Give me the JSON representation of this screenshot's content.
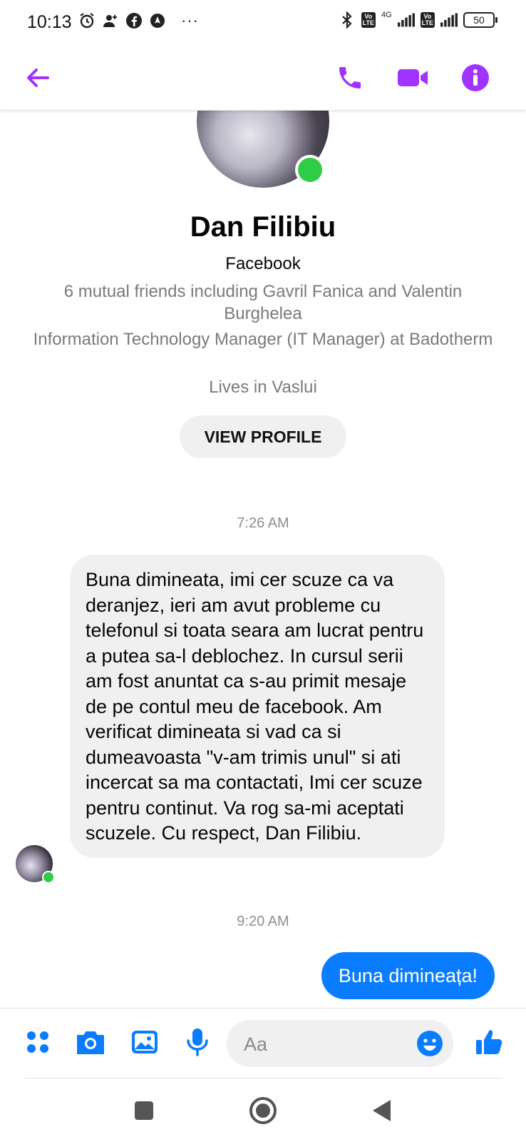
{
  "status_bar": {
    "time": "10:13",
    "network": "4G",
    "battery": "50",
    "more": "···"
  },
  "header": {
    "accent_color": "#a033ff",
    "back_icon": "back-arrow-icon",
    "call_icon": "phone-icon",
    "video_icon": "video-camera-icon",
    "info_icon": "info-icon"
  },
  "profile": {
    "name": "Dan Filibiu",
    "platform": "Facebook",
    "mutual_friends": "6 mutual friends including Gavril Fanica and Valentin Burghelea",
    "work": "Information Technology Manager (IT Manager) at Badotherm",
    "location": "Lives in Vaslui",
    "view_profile_label": "VIEW PROFILE",
    "online": true
  },
  "conversation": {
    "timestamp_1": "7:26 AM",
    "incoming_message": "Buna dimineata, imi cer scuze ca va deranjez, ieri am avut probleme cu telefonul si toata seara am lucrat pentru a putea sa-l deblochez. In cursul serii am fost anuntat ca s-au primit mesaje de pe contul meu de facebook. Am verificat dimineata si vad ca si dumeavoasta \"v-am trimis unul\" si ati incercat sa ma contactati, Imi cer scuze pentru continut. Va rog sa-mi aceptati scuzele. Cu respect, Dan Filibiu.",
    "timestamp_2": "9:20 AM",
    "outgoing_message": "Buna dimineața!",
    "outgoing_color": "#0a7cff"
  },
  "composer": {
    "placeholder": "Aa",
    "icon_color": "#0a7cff",
    "icons": [
      "menu-dots-icon",
      "camera-icon",
      "gallery-icon",
      "microphone-icon",
      "emoji-icon",
      "thumbs-up-icon"
    ]
  },
  "nav_bar": {
    "icons": [
      "recents-square-icon",
      "home-circle-icon",
      "back-triangle-icon"
    ]
  }
}
